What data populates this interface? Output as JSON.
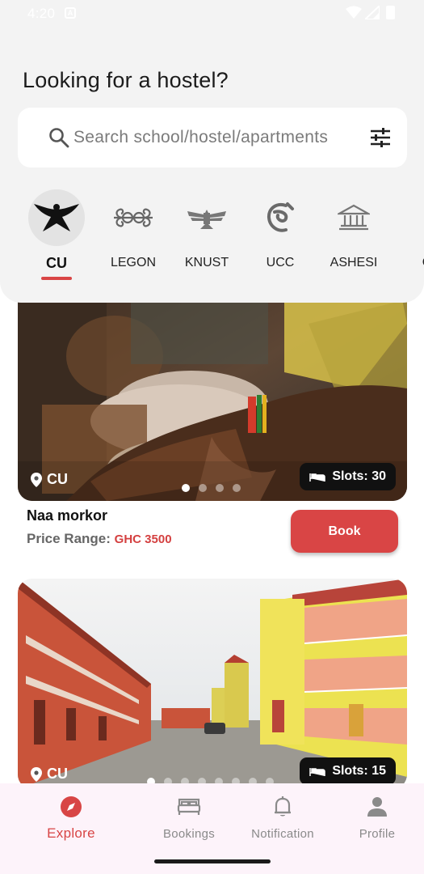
{
  "status_bar": {
    "time": "4:20"
  },
  "header": {
    "title": "Looking for a hostel?",
    "search_placeholder": "Search school/hostel/apartments"
  },
  "schools": [
    {
      "label": "CU",
      "active": true
    },
    {
      "label": "LEGON",
      "active": false
    },
    {
      "label": "KNUST",
      "active": false
    },
    {
      "label": "UCC",
      "active": false
    },
    {
      "label": "ASHESI",
      "active": false
    },
    {
      "label": "G",
      "active": false
    }
  ],
  "listings": [
    {
      "location": "CU",
      "slots": "Slots: 30",
      "name": "Naa morkor",
      "price_label": "Price Range:",
      "price_value": "GHC 3500",
      "book_label": "Book",
      "carousel": {
        "count": 4,
        "active_index": 0
      }
    },
    {
      "location": "CU",
      "slots": "Slots: 15",
      "carousel": {
        "count": 8,
        "active_index": 0
      }
    }
  ],
  "bottom_nav": [
    {
      "label": "Explore",
      "icon": "compass-icon",
      "active": true
    },
    {
      "label": "Bookings",
      "icon": "bed-icon",
      "active": false
    },
    {
      "label": "Notification",
      "icon": "bell-icon",
      "active": false
    },
    {
      "label": "Profile",
      "icon": "person-icon",
      "active": false
    }
  ],
  "colors": {
    "accent": "#d94545",
    "header_bg": "#f3f3f3",
    "nav_bg": "#fdf3fa"
  }
}
